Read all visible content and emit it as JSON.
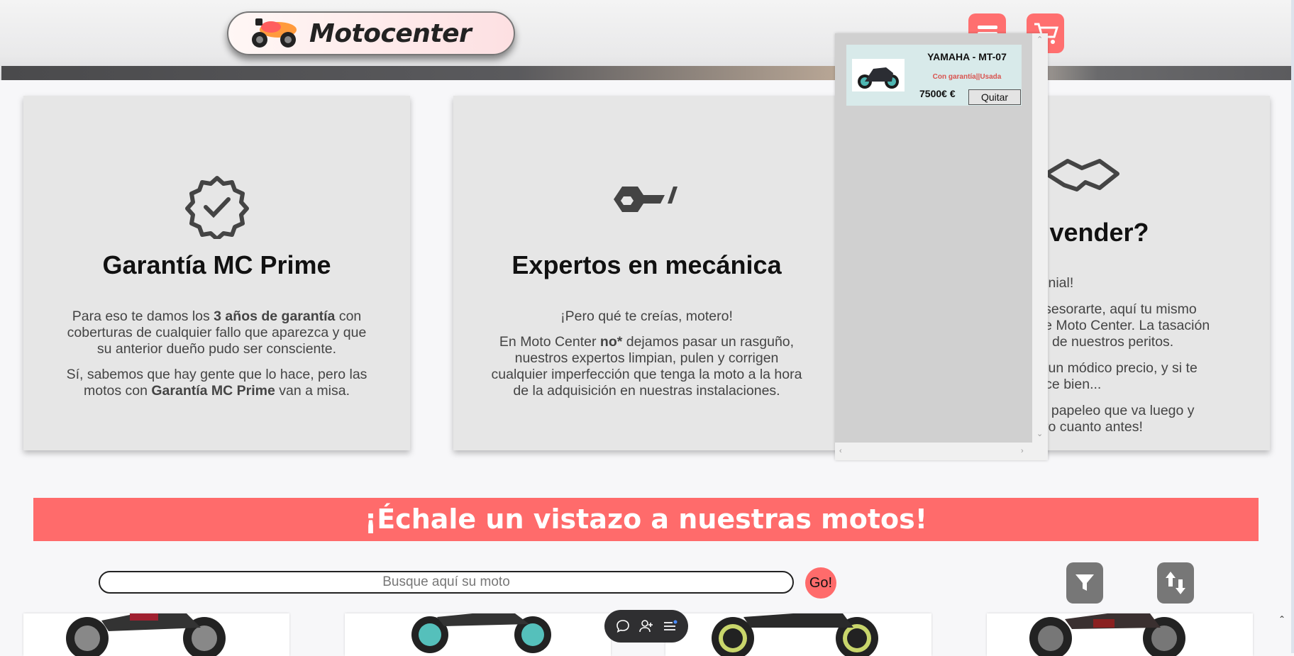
{
  "header": {
    "logo_text": "Motocenter",
    "menu_icon": "hamburger-icon",
    "cart_icon": "cart-icon",
    "accent_color": "#ff6f6f"
  },
  "features": [
    {
      "icon": "badge-check-icon",
      "title": "Garantía MC Prime",
      "p1_a": "Para eso te damos los ",
      "p1_b": "3 años de garantía",
      "p1_c": " con coberturas de cualquier fallo que aparezca y que su anterior dueño pudo ser consciente.",
      "p2_a": "Sí, sabemos que hay gente que lo hace, pero las motos con ",
      "p2_b": "Garantía MC Prime",
      "p2_c": " van a misa."
    },
    {
      "icon": "wrench-icon",
      "title": "Expertos en mecánica",
      "p1": "¡Pero qué te creías, motero!",
      "p2_a": "En Moto Center ",
      "p2_b": "no*",
      "p2_c": " dejamos pasar un rasguño, nuestros expertos limpian, pulen y corrigen cualquier imperfección que tenga la moto a la hora de la adquisición en nuestras instalaciones."
    },
    {
      "icon": "handshake-icon",
      "title": "res vender?",
      "p1": "¡Genial!",
      "p2_line1": "a asesorarte, aquí tu mismo",
      "p2_line2": "e de Moto Center. La tasación",
      "p2_line3": " uno de nuestros peritos.",
      "p3_line1": "o a un módico precio, y si te",
      "p3_line2": "arece bien...",
      "p4_line1": "o el papeleo que va luego y",
      "p4_line2": "inero cuanto antes!"
    }
  ],
  "cart": {
    "item_name": "YAMAHA - MT-07",
    "item_sub": "Con garantía||Usada",
    "item_price": "7500€ €",
    "remove_label": "Quitar"
  },
  "catalog": {
    "banner": "¡Échale un vistazo a nuestras motos!",
    "search_placeholder": "Busque aquí su moto",
    "go_label": "Go!",
    "filter_icon": "filter-icon",
    "sort_icon": "sort-icon"
  },
  "floating_toolbar": {
    "icons": [
      "chat-icon",
      "add-user-icon",
      "list-icon"
    ]
  }
}
